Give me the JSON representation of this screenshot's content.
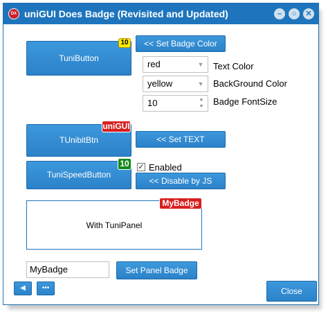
{
  "window": {
    "title": "uniGUI Does Badge (Revisited and Updated)",
    "icon_text": "DX",
    "minimize_glyph": "–",
    "maximize_glyph": "○",
    "close_glyph": "✕"
  },
  "buttons": {
    "tunibutton": {
      "label": "TuniButton",
      "badge": "10"
    },
    "set_badge_color": "<< Set Badge Color",
    "tunibitbtn": {
      "label": "TUnibitBtn",
      "badge": "uniGUI"
    },
    "set_text": "<< Set TEXT",
    "tunispeedbutton": {
      "label": "TuniSpeedButton",
      "badge": "10"
    },
    "disable_by_js": "<< Disable by JS",
    "set_panel_badge": "Set Panel Badge",
    "close": "Close"
  },
  "fields": {
    "text_color": {
      "value": "red",
      "label": "Text Color"
    },
    "background_color": {
      "value": "yellow",
      "label": "BackGround Color"
    },
    "badge_fontsize": {
      "value": "10",
      "label": "Badge FontSize"
    }
  },
  "enabled_checkbox": {
    "label": "Enabled",
    "checked": true,
    "glyph": "✓"
  },
  "panel": {
    "text": "With TuniPanel",
    "badge": "MyBadge"
  },
  "panel_badge_input": {
    "value": "MyBadge"
  },
  "footer": {
    "left_button_glyph": "◀",
    "right_button_glyph": "•••"
  },
  "colors": {
    "titlebar": "#1e75bd",
    "button": "#2b82c8",
    "badge_yellow": "#ffec00",
    "badge_red": "#d81e1e",
    "badge_green": "#138a1e"
  }
}
